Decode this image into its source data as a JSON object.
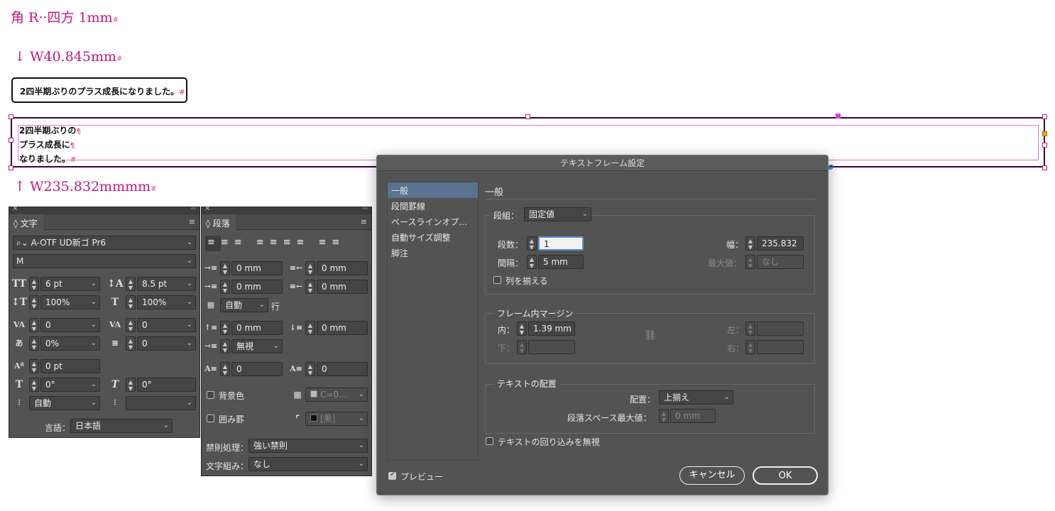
{
  "canvas": {
    "corner_label": "角 R··四方 1mm",
    "width_label_1": "↓ W40.845mm",
    "width_label_2": "↑ W235.832mmmm",
    "end_mark": "#",
    "pilcrow": "¶",
    "box1_text": "2四半期ぶりのプラス成長になりました。",
    "box2_lines": [
      "2四半期ぶりの",
      "プラス成長に",
      "なりました。"
    ]
  },
  "char_panel": {
    "tab": "文字",
    "font": "A-OTF UD新ゴ Pr6",
    "style": "M",
    "size": "6 pt",
    "leading": "8.5 pt",
    "vscale": "100%",
    "hscale": "100%",
    "kerning": "0",
    "tracking": "0",
    "tsume": "0%",
    "aki": "0",
    "baseline": "0 pt",
    "rotate": "0°",
    "skew": "0°",
    "mojikumi": "自動",
    "mojikumi2": "",
    "lang_label": "言語：",
    "lang": "日本語"
  },
  "para_panel": {
    "tab": "段落",
    "left_indent": "0 mm",
    "right_indent": "0 mm",
    "first_indent": "0 mm",
    "last_indent": "0 mm",
    "grid": "自動",
    "grid_suffix": "行",
    "space_before": "0 mm",
    "space_after": "0 mm",
    "align_grid": "無視",
    "drop_lines": "0",
    "drop_chars": "0",
    "bg_label": "背景色",
    "bg_color": "C=0...",
    "border_label": "囲み罫",
    "border_color": "[黒]",
    "kinsoku_label": "禁則処理：",
    "kinsoku": "強い禁則",
    "mojikumi_label": "文字組み：",
    "mojikumi": "なし"
  },
  "dialog": {
    "title": "テキストフレーム設定",
    "nav": [
      "一般",
      "段間罫線",
      "ベースラインオプ...",
      "自動サイズ調整",
      "脚注"
    ],
    "section_title": "一般",
    "columns": {
      "label": "段組：",
      "mode": "固定値",
      "count_label": "段数：",
      "count": "1",
      "gutter_label": "間隔：",
      "gutter": "5 mm",
      "width_label": "幅：",
      "width": "235.832",
      "max_label": "最大値：",
      "max": "なし",
      "balance_label": "列を揃える"
    },
    "inset": {
      "title": "フレーム内マージン",
      "top_label": "内：",
      "top": "1.39 mm",
      "bottom_label": "下：",
      "left_label": "左：",
      "right_label": "右："
    },
    "vjust": {
      "title": "テキストの配置",
      "align_label": "配置：",
      "align": "上揃え",
      "max_space_label": "段落スペース最大値：",
      "max_space": "0 mm"
    },
    "ignore_wrap_label": "テキストの回り込みを無視",
    "preview_label": "プレビュー",
    "cancel": "キャンセル",
    "ok": "OK"
  },
  "colors": {
    "magenta": "#c4177a",
    "panel_bg": "#535353",
    "selection": "#5a7290"
  }
}
